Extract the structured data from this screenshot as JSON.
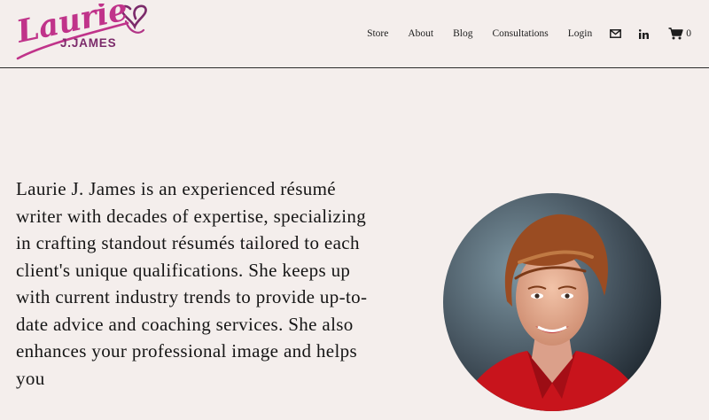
{
  "brand": {
    "logo_script": "Laurie",
    "logo_subtitle": "J.JAMES",
    "colors": {
      "logo_magenta": "#c0338a",
      "text": "#1d1d1d",
      "background": "#f4eeec"
    }
  },
  "nav": {
    "items": [
      {
        "label": "Store"
      },
      {
        "label": "About"
      },
      {
        "label": "Blog"
      },
      {
        "label": "Consultations"
      },
      {
        "label": "Login"
      }
    ],
    "email_icon": "envelope-icon",
    "linkedin_icon": "linkedin-icon",
    "cart": {
      "icon": "cart-icon",
      "count": "0"
    }
  },
  "main": {
    "bio": "Laurie J. James is an experienced résumé writer with decades of expertise, specializing in crafting standout résumés tailored to each client's unique qualifications. She keeps up with current industry trends to provide up-to-date advice and coaching services. She also enhances your professional image and helps you"
  }
}
